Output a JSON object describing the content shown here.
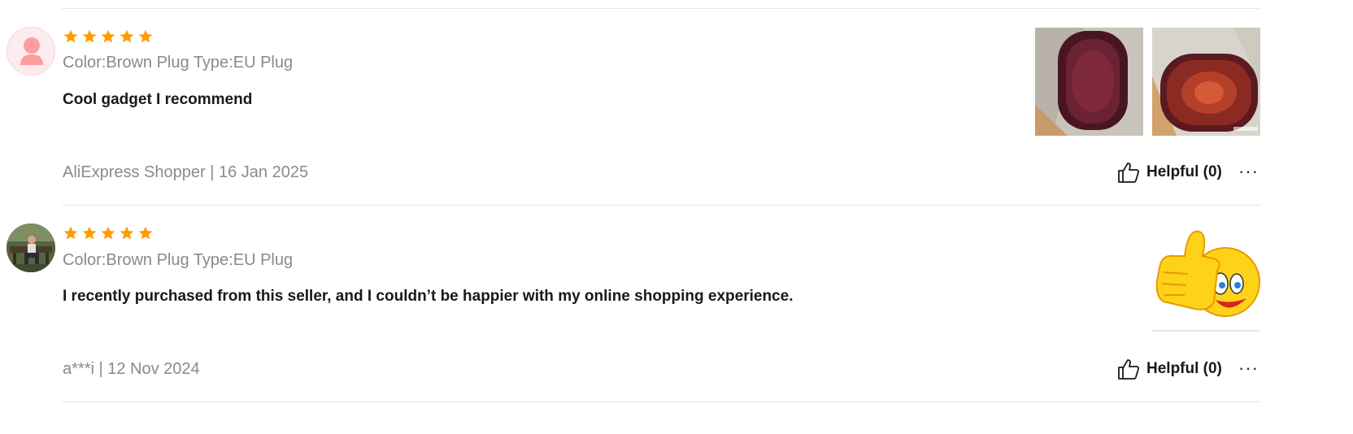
{
  "reviews": [
    {
      "rating": 5,
      "sku": "Color:Brown Plug Type:EU Plug",
      "text": "Cool gadget I recommend",
      "user": "AliExpress Shopper",
      "separator": "|",
      "date": "16 Jan 2025",
      "helpful_label": "Helpful (0)",
      "more_label": "···",
      "avatar": "default-user-avatar",
      "photos": [
        "massager-photo-1",
        "massager-photo-2"
      ]
    },
    {
      "rating": 5,
      "sku": "Color:Brown Plug Type:EU Plug",
      "text": "I recently purchased from this seller, and I couldn’t be happier with my online shopping experience.",
      "user": "a***i",
      "separator": "|",
      "date": "12 Nov 2024",
      "helpful_label": "Helpful (0)",
      "more_label": "···",
      "avatar": "user-photo-avatar",
      "photos": [
        "thumbs-up-emoji-image"
      ]
    }
  ],
  "colors": {
    "star": "#ff9d00",
    "divider": "#e6e6e6",
    "muted_text": "#8a8a8a",
    "body_text": "#191919"
  }
}
